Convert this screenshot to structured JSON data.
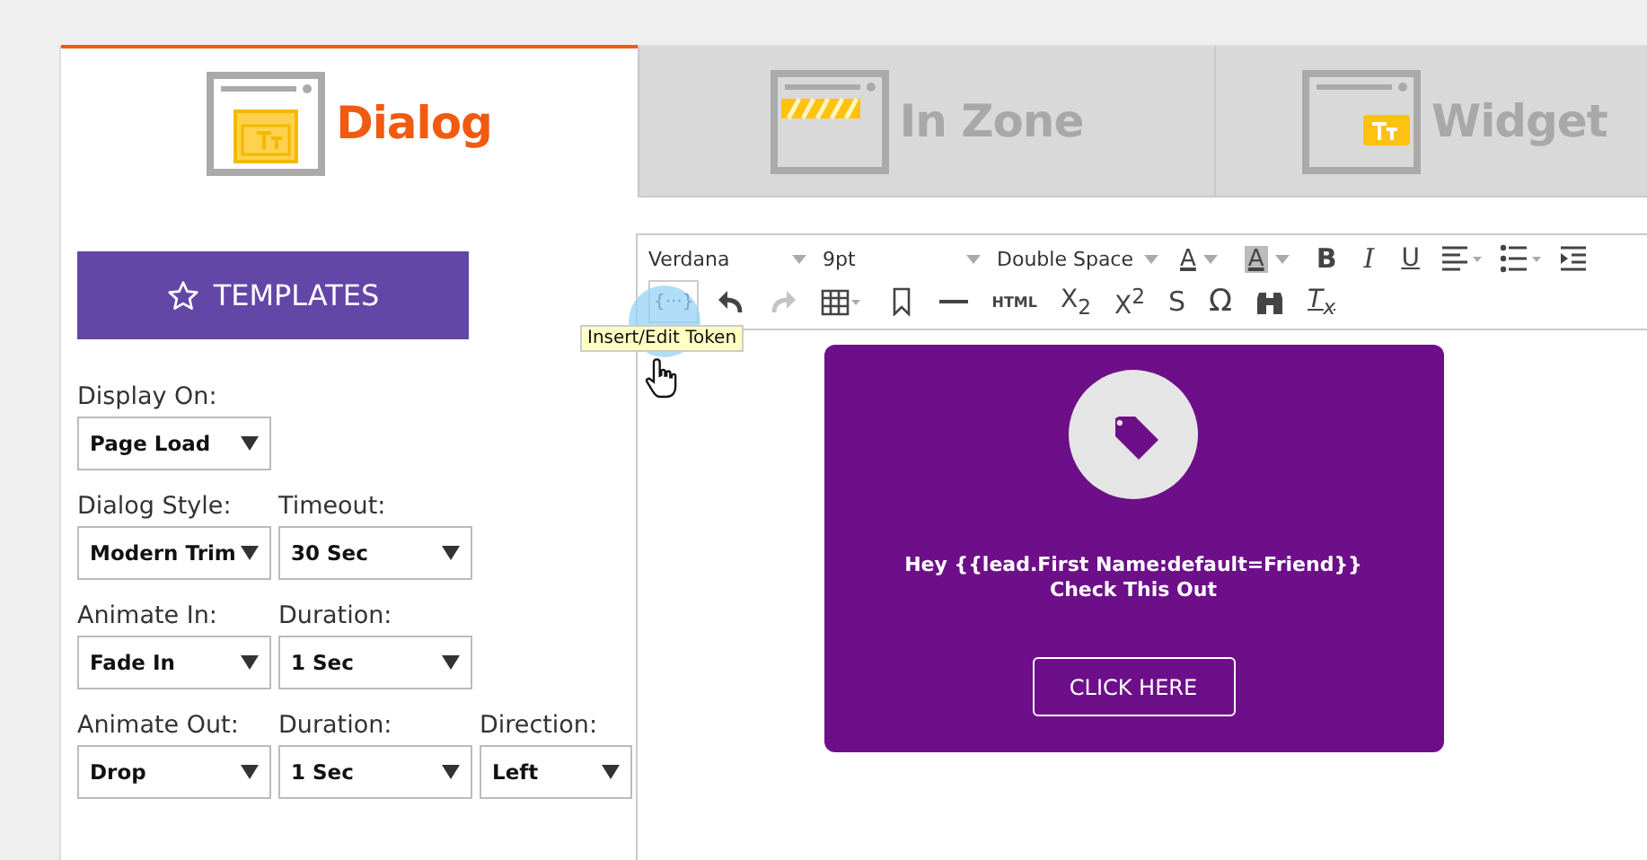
{
  "tabs": [
    {
      "label": "Dialog",
      "kind": "dialog",
      "selected": true
    },
    {
      "label": "In Zone",
      "kind": "zone",
      "selected": false
    },
    {
      "label": "Widget",
      "kind": "widget",
      "selected": false
    }
  ],
  "templates_button": {
    "label": "TEMPLATES"
  },
  "form_rows": [
    {
      "fields": [
        {
          "label": "Display On:",
          "value": "Page Load"
        }
      ]
    },
    {
      "fields": [
        {
          "label": "Dialog Style:",
          "value": "Modern Trim"
        },
        {
          "label": "Timeout:",
          "value": "30 Sec"
        }
      ]
    },
    {
      "fields": [
        {
          "label": "Animate In:",
          "value": "Fade In"
        },
        {
          "label": "Duration:",
          "value": "1 Sec"
        }
      ]
    },
    {
      "fields": [
        {
          "label": "Animate Out:",
          "value": "Drop"
        },
        {
          "label": "Duration:",
          "value": "1 Sec"
        },
        {
          "label": "Direction:",
          "value": "Left"
        }
      ]
    }
  ],
  "toolbar_row_1": [
    {
      "kind": "select",
      "value": "Verdana"
    },
    {
      "kind": "select",
      "value": "9pt"
    },
    {
      "kind": "select",
      "value": "Double Space"
    },
    {
      "kind": "textcolor",
      "label": "A"
    },
    {
      "kind": "highlight",
      "label": "A"
    },
    {
      "kind": "bold",
      "label": "B"
    },
    {
      "kind": "italic",
      "label": "I"
    },
    {
      "kind": "underline",
      "label": "U"
    },
    {
      "kind": "align"
    },
    {
      "kind": "list"
    },
    {
      "kind": "indent"
    }
  ],
  "toolbar_row_2": [
    {
      "kind": "token",
      "label": "{···}",
      "disabled": false
    },
    {
      "kind": "undo",
      "disabled": false
    },
    {
      "kind": "redo",
      "disabled": true
    },
    {
      "kind": "table",
      "disabled": false
    },
    {
      "kind": "bookmark",
      "disabled": false
    },
    {
      "kind": "rule",
      "disabled": false
    },
    {
      "kind": "html",
      "label": "HTML",
      "disabled": false
    },
    {
      "kind": "sub",
      "label": "X$_{2}$",
      "disabled": false
    },
    {
      "kind": "sup",
      "label": "X$^{2}$",
      "disabled": false
    },
    {
      "kind": "strike",
      "label": "S",
      "disabled": false
    },
    {
      "kind": "omega",
      "label": "Ω",
      "disabled": false
    },
    {
      "kind": "find",
      "disabled": false
    },
    {
      "kind": "clear",
      "label": "T$_{x}$",
      "disabled": false
    }
  ],
  "tooltip": {
    "text": "Insert/Edit Token"
  },
  "dialog_preview": {
    "message_line_1": "Hey {{lead.First Name:default=Friend}}",
    "message_line_2": "Check This Out",
    "button": "CLICK HERE"
  }
}
